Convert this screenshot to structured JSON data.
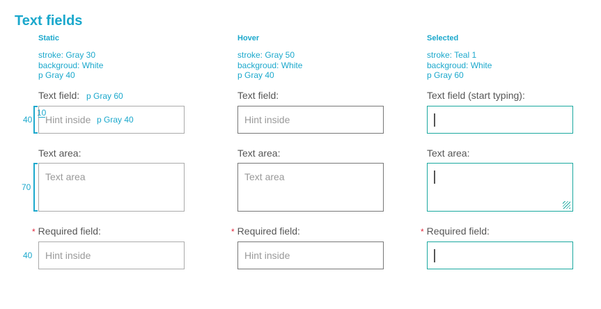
{
  "title": "Text fields",
  "columns": [
    {
      "header": "Static",
      "spec": [
        "stroke: Gray 30",
        "backgroud: White",
        "p Gray 40"
      ],
      "field_label": "Text field:",
      "field_hint": "Hint inside",
      "textarea_label": "Text area:",
      "textarea_hint": "Text area",
      "required_label": "Required field:",
      "required_hint": "Hint inside"
    },
    {
      "header": "Hover",
      "spec": [
        "stroke: Gray 50",
        "backgroud: White",
        "p Gray 40"
      ],
      "field_label": "Text field:",
      "field_hint": "Hint inside",
      "textarea_label": "Text area:",
      "textarea_hint": "Text area",
      "required_label": "Required field:",
      "required_hint": "Hint inside"
    },
    {
      "header": "Selected",
      "spec": [
        "stroke: Teal 1",
        "backgroud: White",
        "p Gray 60"
      ],
      "field_label": "Text field (start typing):",
      "textarea_label": "Text area:",
      "required_label": "Required field:"
    }
  ],
  "annotations": {
    "label_color": "p Gray 60",
    "hint_color": "p Gray 40",
    "field_height": "40",
    "padding": "10",
    "textarea_height": "70",
    "required_height": "40"
  },
  "required_marker": "*",
  "colors": {
    "accent": "#1ba8cc",
    "teal": "#1aa89f",
    "required": "#e0283c"
  }
}
